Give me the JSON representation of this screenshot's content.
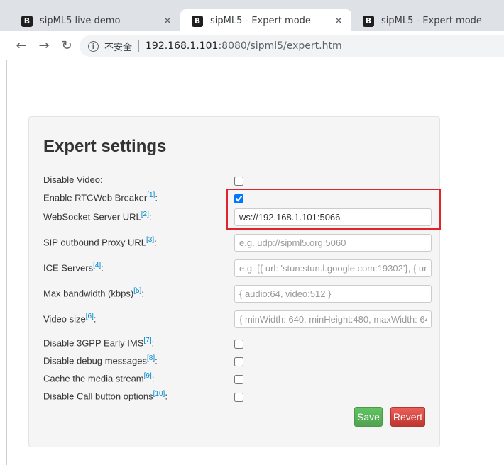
{
  "browser": {
    "tabs": [
      {
        "title": "sipML5 live demo",
        "favicon": "B",
        "close": "✕"
      },
      {
        "title": "sipML5 - Expert mode",
        "favicon": "B",
        "close": "✕"
      },
      {
        "title": "sipML5 - Expert mode",
        "favicon": "B"
      }
    ],
    "security_label": "不安全",
    "url_host": "192.168.1.101",
    "url_rest": ":8080/sipml5/expert.htm"
  },
  "settings": {
    "heading": "Expert settings",
    "disable_video": {
      "label": "Disable Video:",
      "checked": false
    },
    "enable_rtcweb_breaker": {
      "label": "Enable RTCWeb Breaker",
      "ref": "[1]",
      "suffix": ":",
      "checked": true
    },
    "websocket_url": {
      "label": "WebSocket Server URL",
      "ref": "[2]",
      "suffix": ":",
      "value": "ws://192.168.1.101:5066"
    },
    "sip_outbound_proxy": {
      "label": "SIP outbound Proxy URL",
      "ref": "[3]",
      "suffix": ":",
      "placeholder": "e.g. udp://sipml5.org:5060"
    },
    "ice_servers": {
      "label": "ICE Servers",
      "ref": "[4]",
      "suffix": ":",
      "placeholder": "e.g. [{ url: 'stun:stun.l.google.com:19302'}, { url"
    },
    "max_bandwidth": {
      "label": "Max bandwidth (kbps)",
      "ref": "[5]",
      "suffix": ":",
      "placeholder": "{ audio:64, video:512 }"
    },
    "video_size": {
      "label": "Video size",
      "ref": "[6]",
      "suffix": ":",
      "placeholder": "{ minWidth: 640, minHeight:480, maxWidth: 64"
    },
    "disable_3gpp_early_ims": {
      "label": "Disable 3GPP Early IMS",
      "ref": "[7]",
      "suffix": ":",
      "checked": false
    },
    "disable_debug_messages": {
      "label": "Disable debug messages",
      "ref": "[8]",
      "suffix": ":",
      "checked": false
    },
    "cache_media_stream": {
      "label": "Cache the media stream",
      "ref": "[9]",
      "suffix": ":",
      "checked": false
    },
    "disable_call_button_options": {
      "label": "Disable Call button options",
      "ref": "[10]",
      "suffix": ":",
      "checked": false
    },
    "save_label": "Save",
    "revert_label": "Revert"
  },
  "colors": {
    "highlight_border": "#e0242b",
    "save_button": "#51a351",
    "revert_button": "#bd362f",
    "link": "#0088cc"
  }
}
